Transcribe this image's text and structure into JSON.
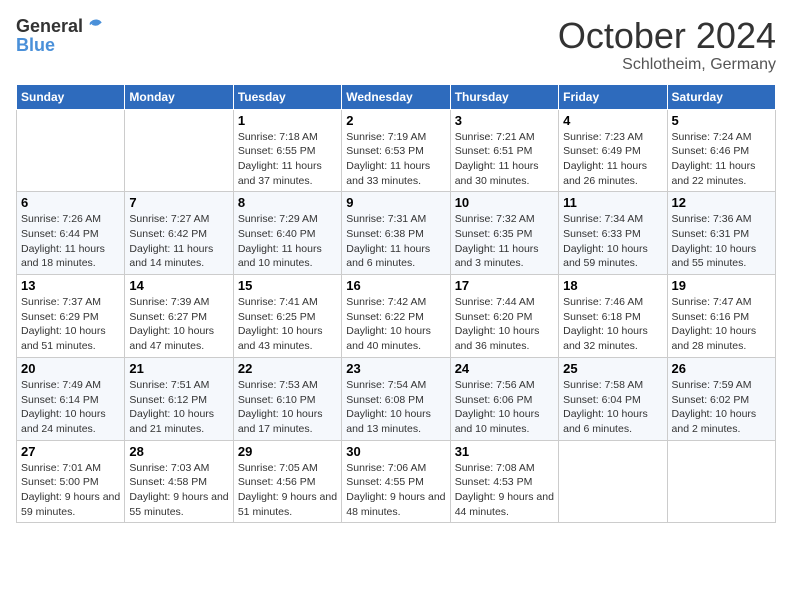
{
  "header": {
    "logo_general": "General",
    "logo_blue": "Blue",
    "month": "October 2024",
    "location": "Schlotheim, Germany"
  },
  "weekdays": [
    "Sunday",
    "Monday",
    "Tuesday",
    "Wednesday",
    "Thursday",
    "Friday",
    "Saturday"
  ],
  "weeks": [
    [
      {
        "day": "",
        "sunrise": "",
        "sunset": "",
        "daylight": ""
      },
      {
        "day": "",
        "sunrise": "",
        "sunset": "",
        "daylight": ""
      },
      {
        "day": "1",
        "sunrise": "Sunrise: 7:18 AM",
        "sunset": "Sunset: 6:55 PM",
        "daylight": "Daylight: 11 hours and 37 minutes."
      },
      {
        "day": "2",
        "sunrise": "Sunrise: 7:19 AM",
        "sunset": "Sunset: 6:53 PM",
        "daylight": "Daylight: 11 hours and 33 minutes."
      },
      {
        "day": "3",
        "sunrise": "Sunrise: 7:21 AM",
        "sunset": "Sunset: 6:51 PM",
        "daylight": "Daylight: 11 hours and 30 minutes."
      },
      {
        "day": "4",
        "sunrise": "Sunrise: 7:23 AM",
        "sunset": "Sunset: 6:49 PM",
        "daylight": "Daylight: 11 hours and 26 minutes."
      },
      {
        "day": "5",
        "sunrise": "Sunrise: 7:24 AM",
        "sunset": "Sunset: 6:46 PM",
        "daylight": "Daylight: 11 hours and 22 minutes."
      }
    ],
    [
      {
        "day": "6",
        "sunrise": "Sunrise: 7:26 AM",
        "sunset": "Sunset: 6:44 PM",
        "daylight": "Daylight: 11 hours and 18 minutes."
      },
      {
        "day": "7",
        "sunrise": "Sunrise: 7:27 AM",
        "sunset": "Sunset: 6:42 PM",
        "daylight": "Daylight: 11 hours and 14 minutes."
      },
      {
        "day": "8",
        "sunrise": "Sunrise: 7:29 AM",
        "sunset": "Sunset: 6:40 PM",
        "daylight": "Daylight: 11 hours and 10 minutes."
      },
      {
        "day": "9",
        "sunrise": "Sunrise: 7:31 AM",
        "sunset": "Sunset: 6:38 PM",
        "daylight": "Daylight: 11 hours and 6 minutes."
      },
      {
        "day": "10",
        "sunrise": "Sunrise: 7:32 AM",
        "sunset": "Sunset: 6:35 PM",
        "daylight": "Daylight: 11 hours and 3 minutes."
      },
      {
        "day": "11",
        "sunrise": "Sunrise: 7:34 AM",
        "sunset": "Sunset: 6:33 PM",
        "daylight": "Daylight: 10 hours and 59 minutes."
      },
      {
        "day": "12",
        "sunrise": "Sunrise: 7:36 AM",
        "sunset": "Sunset: 6:31 PM",
        "daylight": "Daylight: 10 hours and 55 minutes."
      }
    ],
    [
      {
        "day": "13",
        "sunrise": "Sunrise: 7:37 AM",
        "sunset": "Sunset: 6:29 PM",
        "daylight": "Daylight: 10 hours and 51 minutes."
      },
      {
        "day": "14",
        "sunrise": "Sunrise: 7:39 AM",
        "sunset": "Sunset: 6:27 PM",
        "daylight": "Daylight: 10 hours and 47 minutes."
      },
      {
        "day": "15",
        "sunrise": "Sunrise: 7:41 AM",
        "sunset": "Sunset: 6:25 PM",
        "daylight": "Daylight: 10 hours and 43 minutes."
      },
      {
        "day": "16",
        "sunrise": "Sunrise: 7:42 AM",
        "sunset": "Sunset: 6:22 PM",
        "daylight": "Daylight: 10 hours and 40 minutes."
      },
      {
        "day": "17",
        "sunrise": "Sunrise: 7:44 AM",
        "sunset": "Sunset: 6:20 PM",
        "daylight": "Daylight: 10 hours and 36 minutes."
      },
      {
        "day": "18",
        "sunrise": "Sunrise: 7:46 AM",
        "sunset": "Sunset: 6:18 PM",
        "daylight": "Daylight: 10 hours and 32 minutes."
      },
      {
        "day": "19",
        "sunrise": "Sunrise: 7:47 AM",
        "sunset": "Sunset: 6:16 PM",
        "daylight": "Daylight: 10 hours and 28 minutes."
      }
    ],
    [
      {
        "day": "20",
        "sunrise": "Sunrise: 7:49 AM",
        "sunset": "Sunset: 6:14 PM",
        "daylight": "Daylight: 10 hours and 24 minutes."
      },
      {
        "day": "21",
        "sunrise": "Sunrise: 7:51 AM",
        "sunset": "Sunset: 6:12 PM",
        "daylight": "Daylight: 10 hours and 21 minutes."
      },
      {
        "day": "22",
        "sunrise": "Sunrise: 7:53 AM",
        "sunset": "Sunset: 6:10 PM",
        "daylight": "Daylight: 10 hours and 17 minutes."
      },
      {
        "day": "23",
        "sunrise": "Sunrise: 7:54 AM",
        "sunset": "Sunset: 6:08 PM",
        "daylight": "Daylight: 10 hours and 13 minutes."
      },
      {
        "day": "24",
        "sunrise": "Sunrise: 7:56 AM",
        "sunset": "Sunset: 6:06 PM",
        "daylight": "Daylight: 10 hours and 10 minutes."
      },
      {
        "day": "25",
        "sunrise": "Sunrise: 7:58 AM",
        "sunset": "Sunset: 6:04 PM",
        "daylight": "Daylight: 10 hours and 6 minutes."
      },
      {
        "day": "26",
        "sunrise": "Sunrise: 7:59 AM",
        "sunset": "Sunset: 6:02 PM",
        "daylight": "Daylight: 10 hours and 2 minutes."
      }
    ],
    [
      {
        "day": "27",
        "sunrise": "Sunrise: 7:01 AM",
        "sunset": "Sunset: 5:00 PM",
        "daylight": "Daylight: 9 hours and 59 minutes."
      },
      {
        "day": "28",
        "sunrise": "Sunrise: 7:03 AM",
        "sunset": "Sunset: 4:58 PM",
        "daylight": "Daylight: 9 hours and 55 minutes."
      },
      {
        "day": "29",
        "sunrise": "Sunrise: 7:05 AM",
        "sunset": "Sunset: 4:56 PM",
        "daylight": "Daylight: 9 hours and 51 minutes."
      },
      {
        "day": "30",
        "sunrise": "Sunrise: 7:06 AM",
        "sunset": "Sunset: 4:55 PM",
        "daylight": "Daylight: 9 hours and 48 minutes."
      },
      {
        "day": "31",
        "sunrise": "Sunrise: 7:08 AM",
        "sunset": "Sunset: 4:53 PM",
        "daylight": "Daylight: 9 hours and 44 minutes."
      },
      {
        "day": "",
        "sunrise": "",
        "sunset": "",
        "daylight": ""
      },
      {
        "day": "",
        "sunrise": "",
        "sunset": "",
        "daylight": ""
      }
    ]
  ]
}
